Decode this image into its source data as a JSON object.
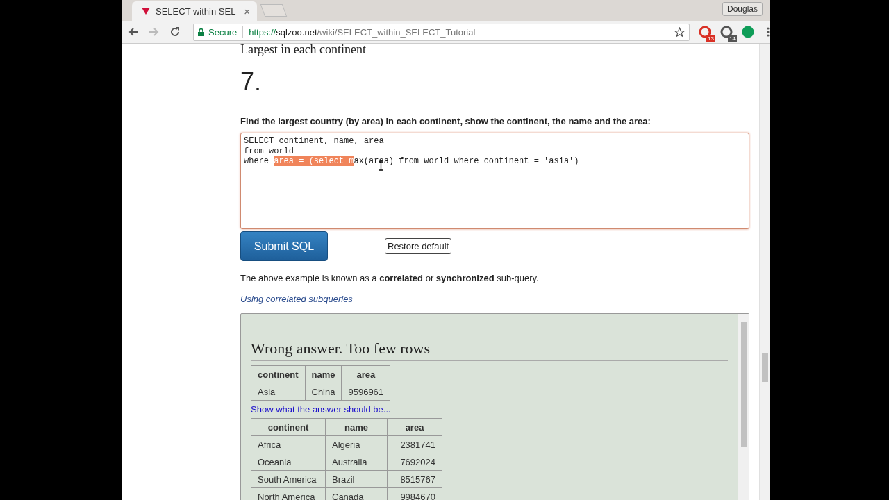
{
  "browser": {
    "tab": {
      "title": "SELECT within SEL",
      "close": "×"
    },
    "user": "Douglas",
    "address": {
      "secure_label": "Secure",
      "scheme": "https://",
      "host": "sqlzoo.net",
      "path": "/wiki/SELECT_within_SELECT_Tutorial"
    },
    "extensions": [
      {
        "badge": "13",
        "color": "#d93025"
      },
      {
        "badge": "14",
        "color": "#555555"
      },
      {
        "color": "#0f9d58"
      }
    ]
  },
  "page": {
    "section_heading": "Largest in each continent",
    "number": "7.",
    "question": "Find the largest country (by area) in each continent, show the continent, the name and the area:",
    "code_lines": [
      [
        {
          "text": "SELECT continent, name, area",
          "selected": false
        }
      ],
      [
        {
          "text": "from world",
          "selected": false
        }
      ],
      [
        {
          "text": "where ",
          "selected": false
        },
        {
          "text": "area = (select m",
          "selected": true
        },
        {
          "text": "ax(area) from world where continent = 'asia')",
          "selected": false
        }
      ]
    ],
    "submit_button": "Submit SQL",
    "restore_button": "Restore default",
    "note": "The above example is known as a **correlated** or **synchronized** sub-query.",
    "help_link": "Using correlated subqueries",
    "result": {
      "message": "Wrong answer. Too few rows",
      "your_table": {
        "columns": [
          "continent",
          "name",
          "area"
        ],
        "rows": [
          [
            "Asia",
            "China",
            "9596961"
          ]
        ]
      },
      "show_answer_link": "Show what the answer should be...",
      "answer_table": {
        "columns": [
          "continent",
          "name",
          "area"
        ],
        "rows": [
          [
            "Africa",
            "Algeria",
            "2381741"
          ],
          [
            "Oceania",
            "Australia",
            "7692024"
          ],
          [
            "South America",
            "Brazil",
            "8515767"
          ],
          [
            "North America",
            "Canada",
            "9984670"
          ]
        ]
      }
    }
  }
}
